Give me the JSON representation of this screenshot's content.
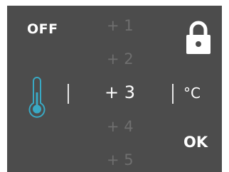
{
  "controls": {
    "off_label": "OFF",
    "ok_label": "OK"
  },
  "temperature": {
    "unit": "°C",
    "options": [
      "+ 1",
      "+ 2",
      "+ 3",
      "+ 4",
      "+ 5"
    ],
    "selected_index": 2
  },
  "icons": {
    "lock": "lock-icon",
    "thermometer": "thermometer-icon"
  },
  "colors": {
    "panel_background": "#4c4c4c",
    "text_active": "#ffffff",
    "text_inactive": "#6f6f6f",
    "thermometer_accent": "#39a9c4"
  }
}
